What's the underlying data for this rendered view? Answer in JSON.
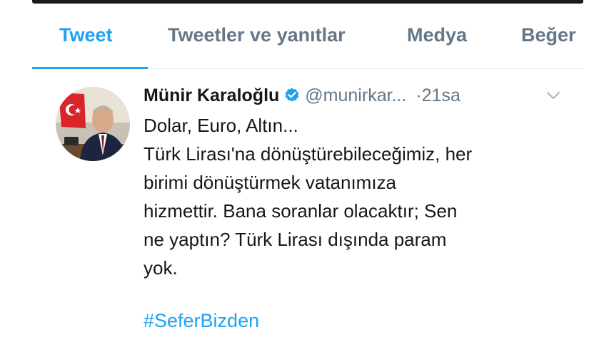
{
  "tabs": [
    {
      "label": "Tweet",
      "active": true
    },
    {
      "label": "Tweetler ve yanıtlar",
      "active": false
    },
    {
      "label": "Medya",
      "active": false
    },
    {
      "label": "Beğer",
      "active": false
    }
  ],
  "tweet": {
    "author_name": "Münir Karaloğlu",
    "handle": "@munirkar...",
    "time_prefix": "·",
    "time": "21sa",
    "text_lines": [
      "Dolar, Euro, Altın...",
      "Türk Lirası'na dönüştürebileceğimiz, her",
      "birimi dönüştürmek vatanımıza",
      "hizmettir. Bana soranlar olacaktır; Sen",
      "ne yaptın? Türk Lirası dışında param",
      "yok."
    ],
    "hashtag": "#SeferBizden",
    "avatar_icon": "profile-photo",
    "verified_icon": "verified-badge-icon",
    "menu_icon": "chevron-down-icon"
  },
  "colors": {
    "accent": "#1da1f2",
    "text_primary": "#14171a",
    "text_secondary": "#657786"
  }
}
